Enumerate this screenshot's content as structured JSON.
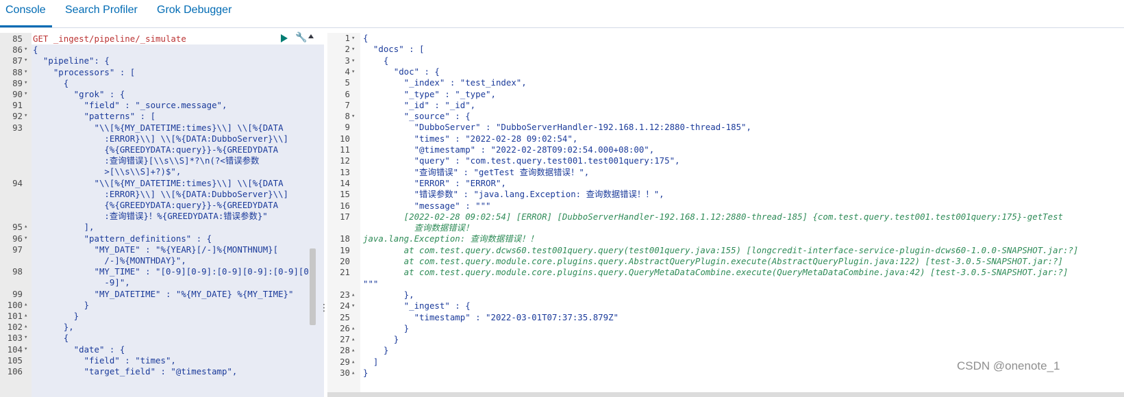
{
  "tabs": [
    {
      "label": "Console"
    },
    {
      "label": "Search Profiler"
    },
    {
      "label": "Grok Debugger"
    }
  ],
  "left_lines": [
    {
      "n": "85",
      "f": "",
      "t": "GET _ingest/pipeline/_simulate"
    },
    {
      "n": "86",
      "f": "▾",
      "t": "{"
    },
    {
      "n": "87",
      "f": "▾",
      "t": "  \"pipeline\": {"
    },
    {
      "n": "88",
      "f": "▾",
      "t": "    \"processors\" : ["
    },
    {
      "n": "89",
      "f": "▾",
      "t": "      {"
    },
    {
      "n": "90",
      "f": "▾",
      "t": "        \"grok\" : {"
    },
    {
      "n": "91",
      "f": "",
      "t": "          \"field\" : \"_source.message\","
    },
    {
      "n": "92",
      "f": "▾",
      "t": "          \"patterns\" : ["
    },
    {
      "n": "93",
      "f": "",
      "t": "            \"\\\\[%{MY_DATETIME:times}\\\\] \\\\[%{DATA"
    },
    {
      "n": "",
      "f": "",
      "t": "              :ERROR}\\\\] \\\\[%{DATA:DubboServer}\\\\]"
    },
    {
      "n": "",
      "f": "",
      "t": "              {%{GREEDYDATA:query}}-%{GREEDYDATA"
    },
    {
      "n": "",
      "f": "",
      "t": "              :查询错误}[\\\\s\\\\S]*?\\n(?<错误参数"
    },
    {
      "n": "",
      "f": "",
      "t": "              >[\\\\s\\\\S]+?)$\","
    },
    {
      "n": "94",
      "f": "",
      "t": "            \"\\\\[%{MY_DATETIME:times}\\\\] \\\\[%{DATA"
    },
    {
      "n": "",
      "f": "",
      "t": "              :ERROR}\\\\] \\\\[%{DATA:DubboServer}\\\\]"
    },
    {
      "n": "",
      "f": "",
      "t": "              {%{GREEDYDATA:query}}-%{GREEDYDATA"
    },
    {
      "n": "",
      "f": "",
      "t": "              :查询错误}！%{GREEDYDATA:错误参数}\""
    },
    {
      "n": "95",
      "f": "▴",
      "t": "          ],"
    },
    {
      "n": "96",
      "f": "▾",
      "t": "          \"pattern_definitions\" : {"
    },
    {
      "n": "97",
      "f": "",
      "t": "            \"MY_DATE\" : \"%{YEAR}[/-]%{MONTHNUM}["
    },
    {
      "n": "",
      "f": "",
      "t": "              /-]%{MONTHDAY}\","
    },
    {
      "n": "98",
      "f": "",
      "t": "            \"MY_TIME\" : \"[0-9][0-9]:[0-9][0-9]:[0-9][0"
    },
    {
      "n": "",
      "f": "",
      "t": "              -9]\","
    },
    {
      "n": "99",
      "f": "",
      "t": "            \"MY_DATETIME\" : \"%{MY_DATE} %{MY_TIME}\""
    },
    {
      "n": "100",
      "f": "▴",
      "t": "          }"
    },
    {
      "n": "101",
      "f": "▴",
      "t": "        }"
    },
    {
      "n": "102",
      "f": "▴",
      "t": "      },"
    },
    {
      "n": "103",
      "f": "▾",
      "t": "      {"
    },
    {
      "n": "104",
      "f": "▾",
      "t": "        \"date\" : {"
    },
    {
      "n": "105",
      "f": "",
      "t": "          \"field\" : \"times\","
    },
    {
      "n": "106",
      "f": "",
      "t": "          \"target_field\" : \"@timestamp\","
    }
  ],
  "right_lines": [
    {
      "n": "1",
      "f": "▾",
      "t": "{",
      "g": false
    },
    {
      "n": "2",
      "f": "▾",
      "t": "  \"docs\" : [",
      "g": false
    },
    {
      "n": "3",
      "f": "▾",
      "t": "    {",
      "g": false
    },
    {
      "n": "4",
      "f": "▾",
      "t": "      \"doc\" : {",
      "g": false
    },
    {
      "n": "5",
      "f": "",
      "t": "        \"_index\" : \"test_index\",",
      "g": false
    },
    {
      "n": "6",
      "f": "",
      "t": "        \"_type\" : \"_type\",",
      "g": false
    },
    {
      "n": "7",
      "f": "",
      "t": "        \"_id\" : \"_id\",",
      "g": false
    },
    {
      "n": "8",
      "f": "▾",
      "t": "        \"_source\" : {",
      "g": false
    },
    {
      "n": "9",
      "f": "",
      "t": "          \"DubboServer\" : \"DubboServerHandler-192.168.1.12:2880-thread-185\",",
      "g": false
    },
    {
      "n": "10",
      "f": "",
      "t": "          \"times\" : \"2022-02-28 09:02:54\",",
      "g": false
    },
    {
      "n": "11",
      "f": "",
      "t": "          \"@timestamp\" : \"2022-02-28T09:02:54.000+08:00\",",
      "g": false
    },
    {
      "n": "12",
      "f": "",
      "t": "          \"query\" : \"com.test.query.test001.test001query:175\",",
      "g": false
    },
    {
      "n": "13",
      "f": "",
      "t": "          \"查询错误\" : \"getTest 查询数据错误！\",",
      "g": false
    },
    {
      "n": "14",
      "f": "",
      "t": "          \"ERROR\" : \"ERROR\",",
      "g": false
    },
    {
      "n": "15",
      "f": "",
      "t": "          \"错误参数\" : \"java.lang.Exception: 查询数据错误！！\",",
      "g": false
    },
    {
      "n": "16",
      "f": "",
      "t": "          \"message\" : \"\"\"",
      "g": false
    },
    {
      "n": "17",
      "f": "",
      "t": "        [2022-02-28 09:02:54] [ERROR] [DubboServerHandler-192.168.1.12:2880-thread-185] {com.test.query.test001.test001query:175}-getTest",
      "g": true
    },
    {
      "n": "",
      "f": "",
      "t": "          查询数据错误！",
      "g": true
    },
    {
      "n": "18",
      "f": "",
      "t": "java.lang.Exception: 查询数据错误！！",
      "g": true
    },
    {
      "n": "19",
      "f": "",
      "t": "        at com.test.query.dcws60.test001query.query(test001query.java:155) [longcredit-interface-service-plugin-dcws60-1.0.0-SNAPSHOT.jar:?]",
      "g": true
    },
    {
      "n": "20",
      "f": "",
      "t": "        at com.test.query.module.core.plugins.query.AbstractQueryPlugin.execute(AbstractQueryPlugin.java:122) [test-3.0.5-SNAPSHOT.jar:?]",
      "g": true
    },
    {
      "n": "21",
      "f": "",
      "t": "        at com.test.query.module.core.plugins.query.QueryMetaDataCombine.execute(QueryMetaDataCombine.java:42) [test-3.0.5-SNAPSHOT.jar:?]",
      "g": true
    },
    {
      "n": "",
      "f": "",
      "t": "\"\"\"",
      "g": false
    },
    {
      "n": "23",
      "f": "▴",
      "t": "        },",
      "g": false
    },
    {
      "n": "24",
      "f": "▾",
      "t": "        \"_ingest\" : {",
      "g": false
    },
    {
      "n": "25",
      "f": "",
      "t": "          \"timestamp\" : \"2022-03-01T07:37:35.879Z\"",
      "g": false
    },
    {
      "n": "26",
      "f": "▴",
      "t": "        }",
      "g": false
    },
    {
      "n": "27",
      "f": "▴",
      "t": "      }",
      "g": false
    },
    {
      "n": "28",
      "f": "▴",
      "t": "    }",
      "g": false
    },
    {
      "n": "29",
      "f": "▴",
      "t": "  ]",
      "g": false
    },
    {
      "n": "30",
      "f": "▴",
      "t": "}",
      "g": false
    }
  ],
  "watermark": "CSDN @onenote_1",
  "icons": {
    "run": "play-icon",
    "settings": "wrench-icon",
    "collapse": "arrow-up-icon",
    "resizer": "vertical-ellipsis-icon"
  }
}
